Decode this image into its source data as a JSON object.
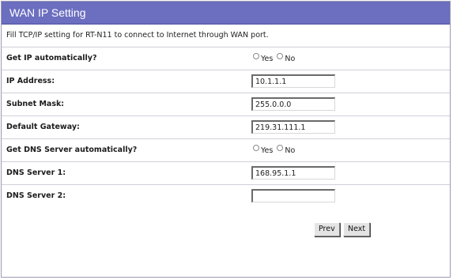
{
  "header": {
    "title": "WAN IP Setting"
  },
  "description": "Fill TCP/IP setting for RT-N11 to connect to Internet through WAN port.",
  "form": {
    "get_ip_auto": {
      "label": "Get IP automatically?",
      "yes": "Yes",
      "no": "No"
    },
    "ip_address": {
      "label": "IP Address:",
      "value": "10.1.1.1"
    },
    "subnet_mask": {
      "label": "Subnet Mask:",
      "value": "255.0.0.0"
    },
    "default_gateway": {
      "label": "Default Gateway:",
      "value": "219.31.111.1"
    },
    "get_dns_auto": {
      "label": "Get DNS Server automatically?",
      "yes": "Yes",
      "no": "No"
    },
    "dns_server_1": {
      "label": "DNS Server 1:",
      "value": "168.95.1.1"
    },
    "dns_server_2": {
      "label": "DNS Server 2:",
      "value": ""
    }
  },
  "buttons": {
    "prev": "Prev",
    "next": "Next"
  },
  "colors": {
    "title_bar": "#6c6ec0",
    "row_divider": "#cfcfd8"
  }
}
